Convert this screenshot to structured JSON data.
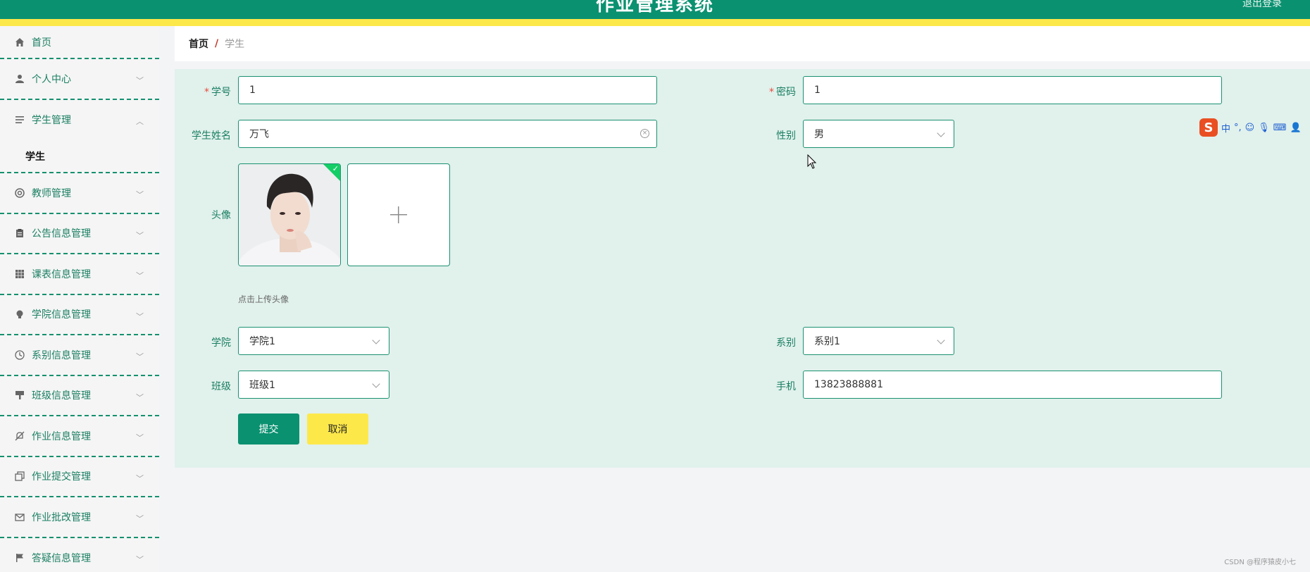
{
  "header": {
    "title": "作业管理系统",
    "right_text": "退出登录"
  },
  "sidebar": {
    "home": "首页",
    "items": [
      {
        "label": "个人中心",
        "icon": "user-icon",
        "chevron": "down"
      },
      {
        "label": "学生管理",
        "icon": "list-icon",
        "chevron": "up"
      },
      {
        "label": "学生",
        "sub": true
      },
      {
        "label": "教师管理",
        "icon": "lifebuoy-icon",
        "chevron": "down"
      },
      {
        "label": "公告信息管理",
        "icon": "clipboard-icon",
        "chevron": "down"
      },
      {
        "label": "课表信息管理",
        "icon": "grid-icon",
        "chevron": "down"
      },
      {
        "label": "学院信息管理",
        "icon": "bulb-icon",
        "chevron": "down"
      },
      {
        "label": "系别信息管理",
        "icon": "clock-icon",
        "chevron": "down"
      },
      {
        "label": "班级信息管理",
        "icon": "brush-icon",
        "chevron": "down"
      },
      {
        "label": "作业信息管理",
        "icon": "bell-off-icon",
        "chevron": "down"
      },
      {
        "label": "作业提交管理",
        "icon": "copy-icon",
        "chevron": "down"
      },
      {
        "label": "作业批改管理",
        "icon": "mail-icon",
        "chevron": "down"
      },
      {
        "label": "答疑信息管理",
        "icon": "flag-icon",
        "chevron": "down"
      }
    ]
  },
  "breadcrumb": {
    "home": "首页",
    "separator": "/",
    "current": "学生"
  },
  "form": {
    "student_no_label": "学号",
    "student_no_value": "1",
    "password_label": "密码",
    "password_value": "1",
    "name_label": "学生姓名",
    "name_value": "万飞",
    "gender_label": "性别",
    "gender_value": "男",
    "avatar_label": "头像",
    "avatar_tip": "点击上传头像",
    "college_label": "学院",
    "college_value": "学院1",
    "department_label": "系别",
    "department_value": "系别1",
    "class_label": "班级",
    "class_value": "班级1",
    "phone_label": "手机",
    "phone_value": "13823888881",
    "submit_label": "提交",
    "cancel_label": "取消",
    "required_mark": "*"
  },
  "ime": {
    "logo": "S",
    "mode": "中",
    "punct": "°,"
  },
  "watermark": "CSDN @程序猿皮小七",
  "colors": {
    "primary": "#0a9170",
    "accent": "#fde84a",
    "form_bg": "#e1f1ec"
  }
}
